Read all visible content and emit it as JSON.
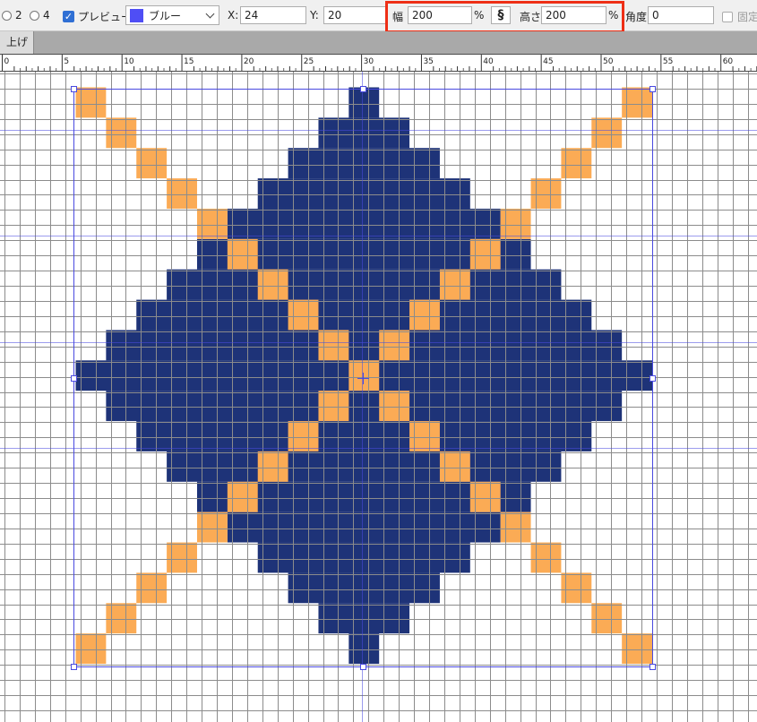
{
  "toolbar": {
    "radio_2_label": "2",
    "radio_4_label": "4",
    "preview_label": "プレビュー",
    "preview_checked": true,
    "color_select_value": "ブルー",
    "color_swatch": "#4f4ef5",
    "x_label": "X:",
    "x_value": "24",
    "y_label": "Y:",
    "y_value": "20",
    "width_label": "幅",
    "width_value": "200",
    "width_unit": "%",
    "height_label": "高さ",
    "height_value": "200",
    "height_unit": "%",
    "angle_label": "角度",
    "angle_value": "0",
    "fixed_label": "固定"
  },
  "tab": {
    "label": "上げ"
  },
  "ruler": {
    "labels": [
      "0",
      "5",
      "10",
      "15",
      "20",
      "25",
      "30",
      "35",
      "40",
      "45",
      "50",
      "55",
      "60"
    ]
  },
  "colors": {
    "blue": "#1e3378",
    "orange": "#fbab55",
    "grid": "#8c8c8c",
    "guide": "#4a4ae0",
    "highlight": "#ee2f16"
  },
  "pattern": {
    "blue_rows": [
      {
        "r": 0,
        "s": 9,
        "e": 9
      },
      {
        "r": 1,
        "s": 8,
        "e": 10
      },
      {
        "r": 2,
        "s": 7,
        "e": 11
      },
      {
        "r": 3,
        "s": 6,
        "e": 12
      },
      {
        "r": 4,
        "s": 5,
        "e": 13
      },
      {
        "r": 5,
        "s": 4,
        "e": 14
      },
      {
        "r": 6,
        "s": 3,
        "e": 15
      },
      {
        "r": 7,
        "s": 2,
        "e": 16
      },
      {
        "r": 8,
        "s": 1,
        "e": 17
      },
      {
        "r": 9,
        "s": 0,
        "e": 18
      },
      {
        "r": 10,
        "s": 1,
        "e": 17
      },
      {
        "r": 11,
        "s": 2,
        "e": 16
      },
      {
        "r": 12,
        "s": 3,
        "e": 15
      },
      {
        "r": 13,
        "s": 4,
        "e": 14
      },
      {
        "r": 14,
        "s": 5,
        "e": 13
      },
      {
        "r": 15,
        "s": 6,
        "e": 12
      },
      {
        "r": 16,
        "s": 7,
        "e": 11
      },
      {
        "r": 17,
        "s": 8,
        "e": 10
      },
      {
        "r": 18,
        "s": 9,
        "e": 9
      }
    ]
  }
}
